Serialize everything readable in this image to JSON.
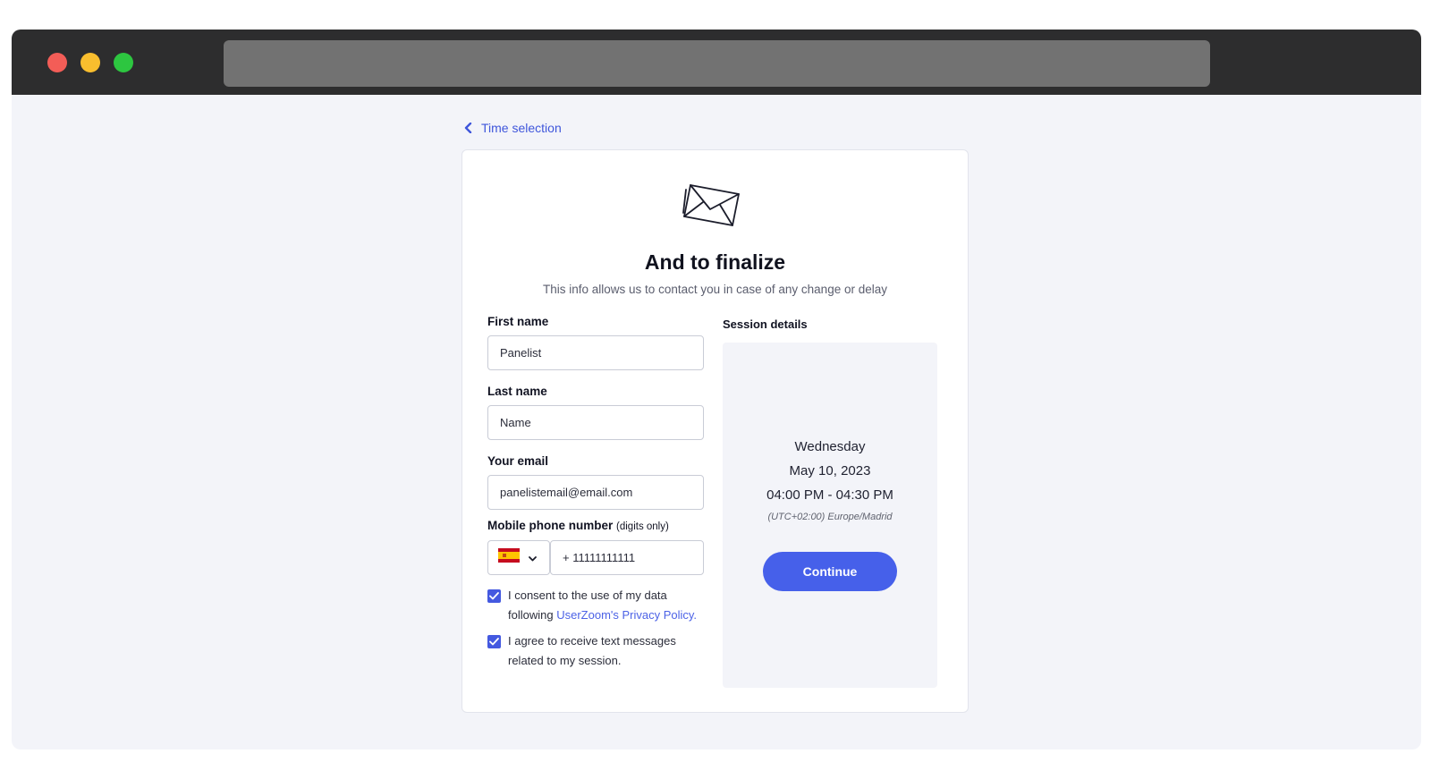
{
  "window": {
    "controls": [
      "close",
      "minimize",
      "maximize"
    ],
    "colors": {
      "titlebar": "#2d2d2e",
      "close": "#f35d57",
      "minimize": "#f9be2e",
      "maximize": "#2dc640"
    }
  },
  "back_link": {
    "label": "Time selection",
    "icon": "chevron-left-icon"
  },
  "card": {
    "icon": "envelope-icon",
    "title": "And to finalize",
    "subtitle": "This info allows us to contact you in case of any change or delay"
  },
  "form": {
    "first_name": {
      "label": "First name",
      "value": "Panelist"
    },
    "last_name": {
      "label": "Last name",
      "value": "Name"
    },
    "email": {
      "label": "Your email",
      "value": "panelistemail@email.com"
    },
    "phone": {
      "label": "Mobile phone number",
      "hint": "(digits only)",
      "country_flag": "spain-flag-icon",
      "value": "+ 11111111111"
    },
    "consent_privacy": {
      "checked": true,
      "text": "I consent to the use of my data following",
      "link_text": "UserZoom's Privacy Policy."
    },
    "consent_sms": {
      "checked": true,
      "text": "I agree to receive text messages related to my session."
    }
  },
  "session": {
    "label": "Session details",
    "day": "Wednesday",
    "date": "May 10, 2023",
    "time": "04:00 PM - 04:30 PM",
    "timezone": "(UTC+02:00) Europe/Madrid",
    "continue_label": "Continue"
  },
  "colors": {
    "accent": "#4660ea",
    "link": "#3f56db",
    "page_bg": "#f3f4f9"
  }
}
